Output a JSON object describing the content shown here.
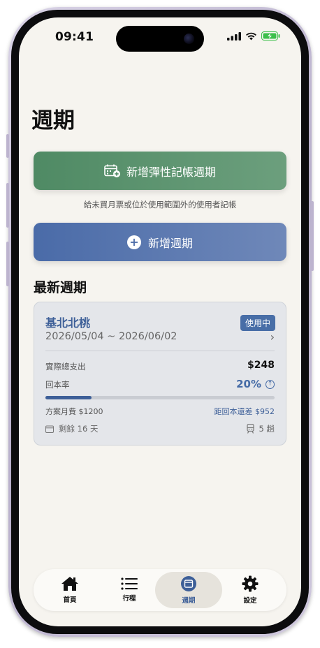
{
  "status": {
    "time": "09:41"
  },
  "page": {
    "title": "週期"
  },
  "actions": {
    "flex_button_label": "新增彈性記帳週期",
    "flex_hint": "給未買月票或位於使用範圍外的使用者記帳",
    "add_button_label": "新增週期",
    "add_icon": "+"
  },
  "latest": {
    "section_title": "最新週期",
    "card": {
      "route": "基北北桃",
      "badge": "使用中",
      "dates": "2026/05/04 ~ 2026/06/02",
      "chevron": "›",
      "total_label": "實際總支出",
      "total_value": "$248",
      "rate_label": "回本率",
      "rate_value": "20%",
      "rate_icon": "↑",
      "progress_fraction": 0.2,
      "plan_label": "方案月費 $1200",
      "remaining_to_break_even": "距回本還差 $952",
      "days_left": "剩餘 16 天",
      "trips": "5 趟"
    }
  },
  "tabbar": {
    "items": [
      {
        "label": "首頁",
        "icon": "home-icon"
      },
      {
        "label": "行程",
        "icon": "list-icon"
      },
      {
        "label": "週期",
        "icon": "cycle-icon",
        "active": true
      },
      {
        "label": "設定",
        "icon": "gear-icon"
      }
    ]
  },
  "colors": {
    "green_button": "#4f8a64",
    "blue_button": "#4a6ba8",
    "accent_blue": "#3d5f98",
    "screen_bg": "#f6f4ef"
  }
}
